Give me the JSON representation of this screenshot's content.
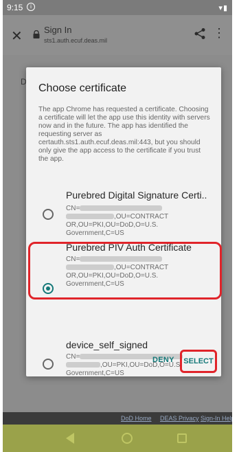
{
  "status_bar": {
    "time": "9:15",
    "icons_right": "▾▮"
  },
  "app_bar": {
    "title": "Sign In",
    "url": "sts1.auth.ecuf.deas.mil",
    "icons": [
      "close-icon",
      "lock-icon",
      "share-icon",
      "more-vert-icon"
    ]
  },
  "page": {
    "fragment": "D"
  },
  "dialog": {
    "title": "Choose certificate",
    "body": "The app Chrome has requested a certificate. Choosing a certificate will let the app use this identity with servers now and in the future. The app has identified the requesting server as certauth.sts1.auth.ecuf.deas.mil:443, but you should only give the app access to the certificate if you trust the app.",
    "certificates": [
      {
        "name": "Purebred Digital Signature Certi..",
        "cn_prefix": "CN=",
        "ou_suffix": ",OU=CONTRACT",
        "line3": "OR,OU=PKI,OU=DoD,O=U.S.",
        "line4": "Government,C=US",
        "selected": false
      },
      {
        "name": "Purebred PIV Auth Certificate",
        "cn_prefix": "CN=",
        "ou_suffix": ",OU=CONTRACT",
        "line3": "OR,OU=PKI,OU=DoD,O=U.S.",
        "line4": "Government,C=US",
        "selected": true
      },
      {
        "name": "device_self_signed",
        "cn_prefix": "CN=",
        "ou_suffix": ",OU=PKI,OU=DoD,O=U.S.",
        "line3": "Government,C=US",
        "selected": false
      }
    ],
    "deny_label": "DENY",
    "select_label": "SELECT"
  },
  "footer": {
    "links": [
      "DoD Home",
      "DEAS Privacy",
      "Sign-In Help"
    ]
  },
  "colors": {
    "accent": "#147878",
    "highlight": "#e0242a",
    "nav_bar": "#9aa24a"
  }
}
